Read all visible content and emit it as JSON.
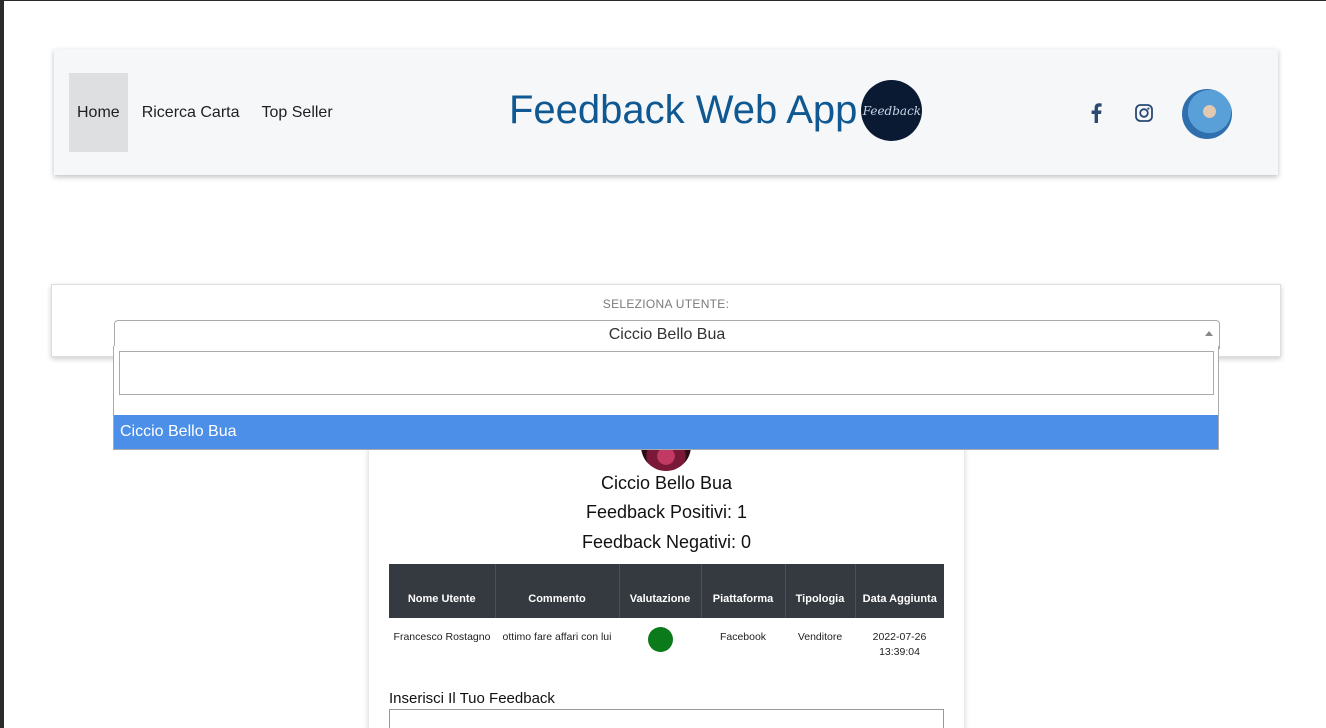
{
  "nav": {
    "links": [
      "Home",
      "Ricerca Carta",
      "Top Seller"
    ],
    "active": "Home"
  },
  "brand": {
    "title": "Feedback Web App",
    "logo_text": "Feedback"
  },
  "icons": {
    "facebook": "facebook-icon",
    "instagram": "instagram-icon",
    "user_avatar": "avatar"
  },
  "selector": {
    "label": "SELEZIONA UTENTE:",
    "selected": "Ciccio Bello Bua",
    "search_value": "",
    "options": [
      "Ciccio Bello Bua"
    ],
    "highlight_color": "#4b8fe8"
  },
  "profile": {
    "name": "Ciccio Bello Bua",
    "positive": "Feedback Positivi: 1",
    "negative": "Feedback Negativi: 0"
  },
  "table": {
    "headers": [
      "Nome Utente",
      "Commento",
      "Valutazione",
      "Piattaforma",
      "Tipologia",
      "Data Aggiunta"
    ],
    "rows": [
      {
        "nome": "Francesco Rostagno",
        "commento": "ottimo fare affari con lui",
        "valutazione": "positive",
        "valutazione_color": "#0a7a1a",
        "piattaforma": "Facebook",
        "tipologia": "Venditore",
        "data": "2022-07-26 13:39:04"
      }
    ]
  },
  "form": {
    "label": "Inserisci Il Tuo Feedback",
    "value": ""
  },
  "colors": {
    "brand": "#0f5891",
    "table_header": "#343a40"
  }
}
